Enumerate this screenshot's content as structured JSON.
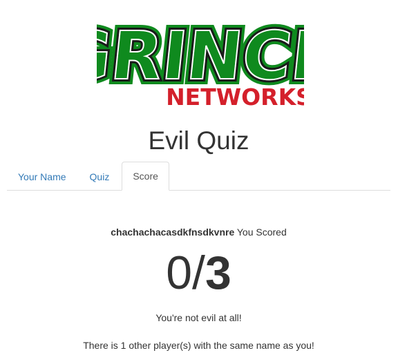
{
  "logo": {
    "title_text": "GRINCH",
    "subtitle_text": "NETWORKS",
    "colors": {
      "outline": "#0f8a1e",
      "fill": "#1a1a1a",
      "highlight": "#ffffff",
      "subtitle": "#d4202b"
    }
  },
  "page": {
    "title": "Evil Quiz"
  },
  "tabs": [
    {
      "label": "Your Name",
      "active": false
    },
    {
      "label": "Quiz",
      "active": false
    },
    {
      "label": "Score",
      "active": true
    }
  ],
  "score": {
    "player_name": "chachachacasdkfnsdkvnre",
    "scored_label": "You Scored",
    "correct": "0",
    "separator": "/",
    "total": "3",
    "verdict": "You're not evil at all!",
    "others_message": "There is 1 other player(s) with the same name as you!"
  },
  "colors": {
    "link": "#337ab7",
    "text": "#333333",
    "border": "#dddddd"
  }
}
